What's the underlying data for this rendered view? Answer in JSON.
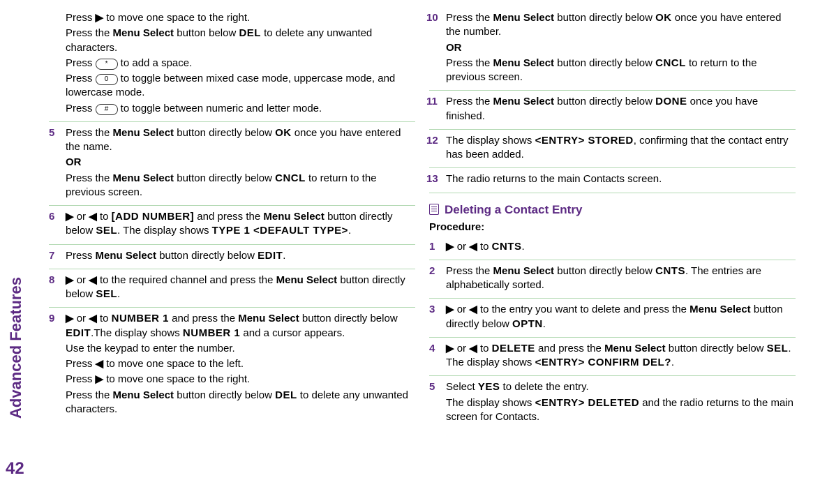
{
  "sidebar_label": "Advanced Features",
  "page_number": "42",
  "left": {
    "cont": {
      "l1a": "Press ",
      "l1b": " to move one space to the right.",
      "l2a": "Press the ",
      "l2b": "Menu Select",
      "l2c": " button below ",
      "l2d": "DEL",
      "l2e": " to delete any unwanted characters.",
      "l3a": "Press ",
      "l3b_key": "*",
      "l3c": " to add a space.",
      "l4a": "Press ",
      "l4b_key": "0",
      "l4c": " to toggle between mixed case mode, uppercase mode, and lowercase mode.",
      "l5a": "Press ",
      "l5b_key": "#",
      "l5c": " to toggle between numeric and letter mode."
    },
    "s5": {
      "num": "5",
      "a": "Press the ",
      "b": "Menu Select",
      "c": " button directly below ",
      "d": "OK",
      "e": " once you have entered the name.",
      "or": "OR",
      "f": "Press the ",
      "g": "Menu Select",
      "h": " button directly below ",
      "i": "CNCL",
      "j": " to return to the previous screen."
    },
    "s6": {
      "num": "6",
      "a": " or ",
      "b": " to ",
      "c": "[ADD NUMBER]",
      "d": " and press the ",
      "e": "Menu Select",
      "f": " button directly below ",
      "g": "SEL",
      "h": ". The display shows ",
      "i": "TYPE 1 <DEFAULT TYPE>",
      "j": "."
    },
    "s7": {
      "num": "7",
      "a": "Press ",
      "b": "Menu Select",
      "c": " button directly below ",
      "d": "EDIT",
      "e": "."
    },
    "s8": {
      "num": "8",
      "a": " or ",
      "b": " to the required channel and press the ",
      "c": "Menu Select",
      "d": " button directly below ",
      "e": "SEL",
      "f": "."
    },
    "s9": {
      "num": "9",
      "a": " or ",
      "b": " to ",
      "c": "NUMBER 1",
      "d": " and press the ",
      "e": "Menu Select",
      "f": " button directly below ",
      "g": "EDIT",
      "h": ".The display shows ",
      "i": "NUMBER 1",
      "j": " and a cursor appears.",
      "k": "Use the keypad to enter the number.",
      "l1a": "Press ",
      "l1b": " to move one space to the left.",
      "l2a": "Press ",
      "l2b": " to move one space to the right.",
      "l3a": "Press the ",
      "l3b": "Menu Select",
      "l3c": " button directly below ",
      "l3d": "DEL",
      "l3e": " to delete any unwanted characters."
    }
  },
  "right": {
    "s10": {
      "num": "10",
      "a": "Press the ",
      "b": "Menu Select",
      "c": " button directly below ",
      "d": "OK",
      "e": " once you have entered the number.",
      "or": "OR",
      "f": "Press the ",
      "g": "Menu Select",
      "h": " button directly below ",
      "i": "CNCL",
      "j": " to return to the previous screen."
    },
    "s11": {
      "num": "11",
      "a": "Press the ",
      "b": "Menu Select",
      "c": " button directly below ",
      "d": "DONE",
      "e": " once you have finished."
    },
    "s12": {
      "num": "12",
      "a": "The display shows ",
      "b": "<ENTRY> STORED",
      "c": ", confirming that the contact entry has been added."
    },
    "s13": {
      "num": "13",
      "a": "The radio returns to the main Contacts screen."
    },
    "section_title": "Deleting a Contact Entry",
    "procedure": "Procedure:",
    "d1": {
      "num": "1",
      "a": " or ",
      "b": " to ",
      "c": "CNTS",
      "d": "."
    },
    "d2": {
      "num": "2",
      "a": "Press the ",
      "b": "Menu Select",
      "c": " button directly below ",
      "d": "CNTS",
      "e": ". The entries are alphabetically sorted."
    },
    "d3": {
      "num": "3",
      "a": " or ",
      "b": " to the entry you want to delete and press the ",
      "c": "Menu Select",
      "d": " button directly below ",
      "e": "OPTN",
      "f": "."
    },
    "d4": {
      "num": "4",
      "a": " or ",
      "b": " to ",
      "c": "DELETE",
      "d": " and press the ",
      "e": "Menu Select",
      "f": " button directly below ",
      "g": "SEL",
      "h": ". The display shows ",
      "i": "<ENTRY> CONFIRM DEL?",
      "j": "."
    },
    "d5": {
      "num": "5",
      "a": "Select ",
      "b": "YES",
      "c": " to delete the entry.",
      "d": "The display shows ",
      "e": "<ENTRY> DELETED",
      "f": " and the radio returns to the main screen for Contacts."
    }
  }
}
